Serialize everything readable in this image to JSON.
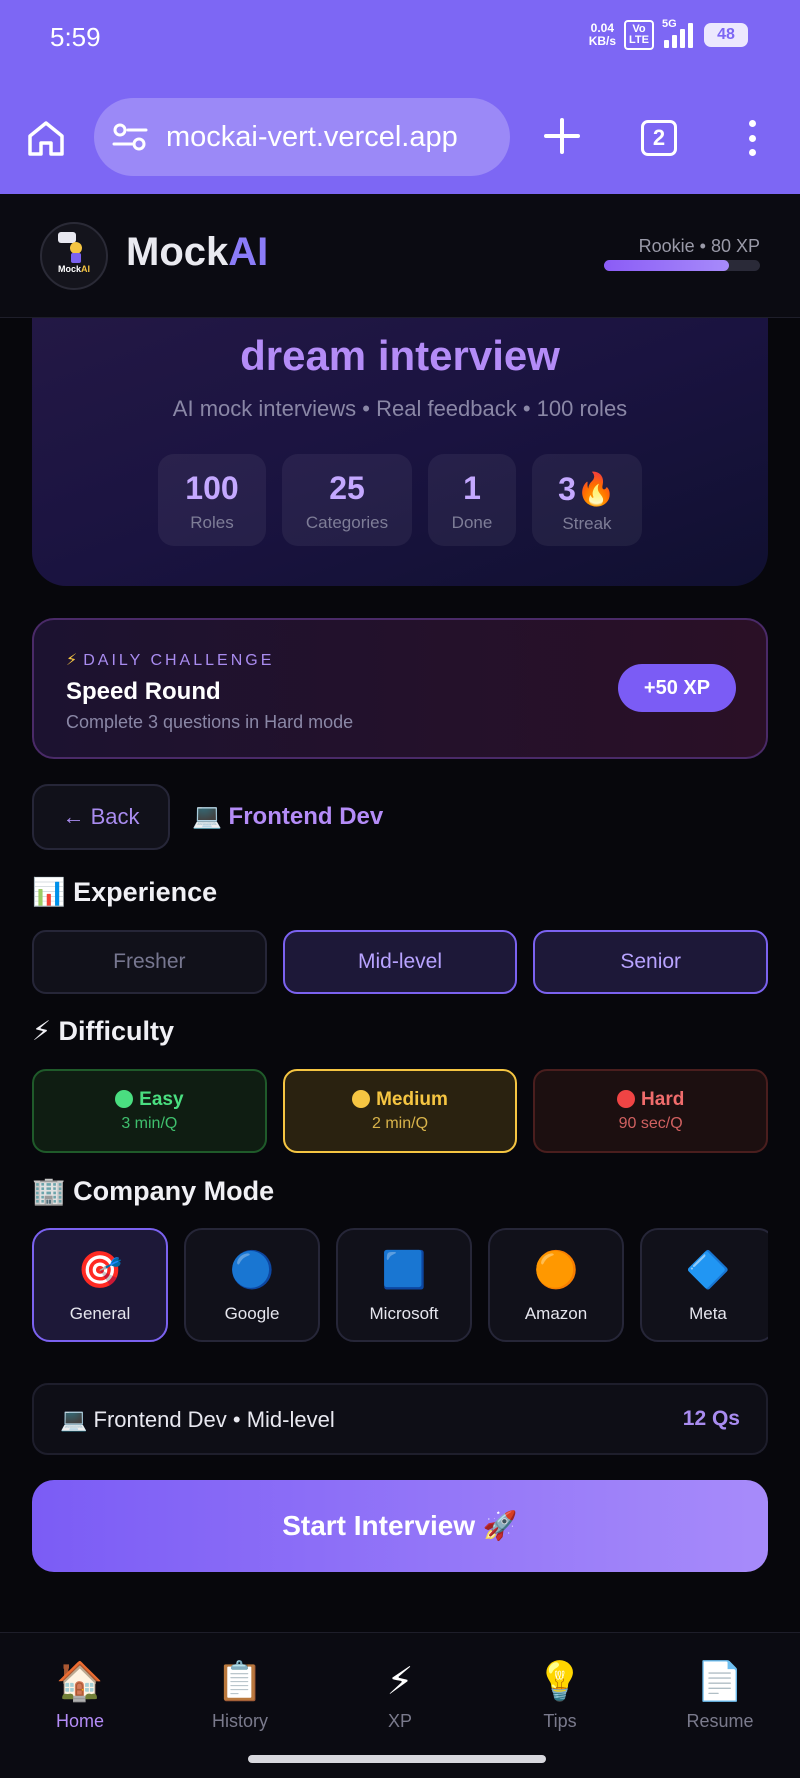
{
  "status": {
    "time": "5:59",
    "net_speed": "0.04",
    "net_unit": "KB/s",
    "volte_1": "Vo",
    "volte_2": "LTE",
    "network": "5G",
    "battery": "48"
  },
  "browser": {
    "url": "mockai-vert.vercel.app",
    "tab_count": "2"
  },
  "header": {
    "brand_a": "Mock",
    "brand_b": "AI",
    "logo_a": "Mock",
    "logo_b": "AI",
    "rank": "Rookie • 80 XP",
    "xp_progress_pct": 80
  },
  "hero": {
    "title": "dream interview",
    "subtitle": "AI mock interviews • Real feedback • 100 roles",
    "stats": [
      {
        "value": "100",
        "label": "Roles"
      },
      {
        "value": "25",
        "label": "Categories"
      },
      {
        "value": "1",
        "label": "Done"
      },
      {
        "value": "3🔥",
        "label": "Streak"
      }
    ]
  },
  "daily": {
    "tag": "DAILY CHALLENGE",
    "title": "Speed Round",
    "desc": "Complete 3 questions in Hard mode",
    "reward": "+50 XP"
  },
  "nav": {
    "back": "← Back",
    "role": "💻 Frontend Dev"
  },
  "experience": {
    "heading": "📊 Experience",
    "options": [
      "Fresher",
      "Mid-level",
      "Senior"
    ],
    "selected": "Mid-level"
  },
  "difficulty": {
    "heading": "⚡ Difficulty",
    "options": [
      {
        "name": "Easy",
        "time": "3 min/Q",
        "color": "#4ade80"
      },
      {
        "name": "Medium",
        "time": "2 min/Q",
        "color": "#f5c542"
      },
      {
        "name": "Hard",
        "time": "90 sec/Q",
        "color": "#ef4444"
      }
    ],
    "selected": "Medium"
  },
  "company": {
    "heading": "🏢 Company Mode",
    "options": [
      {
        "icon": "🎯",
        "name": "General"
      },
      {
        "icon": "🔵",
        "name": "Google"
      },
      {
        "icon": "🟦",
        "name": "Microsoft"
      },
      {
        "icon": "🟠",
        "name": "Amazon"
      },
      {
        "icon": "🔷",
        "name": "Meta"
      }
    ],
    "selected": "General"
  },
  "summary": {
    "left": "💻 Frontend Dev • Mid-level",
    "right": "12 Qs"
  },
  "start": {
    "label": "Start Interview 🚀"
  },
  "bottom_nav": [
    {
      "icon": "🏠",
      "label": "Home"
    },
    {
      "icon": "📋",
      "label": "History"
    },
    {
      "icon": "⚡",
      "label": "XP"
    },
    {
      "icon": "💡",
      "label": "Tips"
    },
    {
      "icon": "📄",
      "label": "Resume"
    }
  ]
}
